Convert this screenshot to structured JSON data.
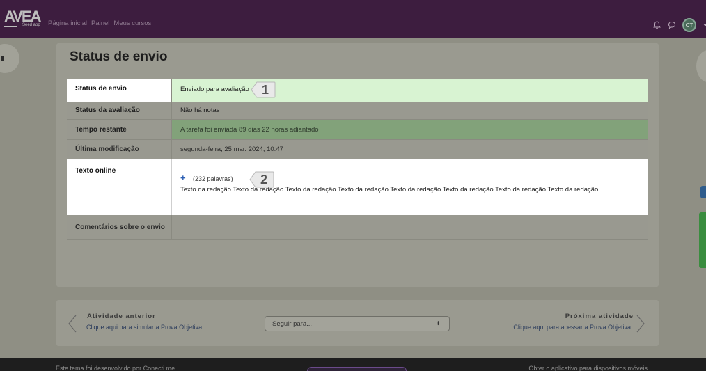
{
  "nav": {
    "logo_text": "AVEA",
    "logo_sub": "Seed app",
    "links": [
      "Página inicial",
      "Painel",
      "Meus cursos"
    ],
    "avatar_initials": "CT"
  },
  "page": {
    "title": "Status de envio"
  },
  "table": {
    "rows": [
      {
        "label": "Status de envio",
        "value": "Enviado para avaliação"
      },
      {
        "label": "Status da avaliação",
        "value": "Não há notas"
      },
      {
        "label": "Tempo restante",
        "value": "A tarefa foi enviada 89 dias 22 horas adiantado"
      },
      {
        "label": "Última modificação",
        "value": "segunda-feira, 25 mar. 2024, 10:47"
      },
      {
        "label": "Texto online",
        "value": ""
      },
      {
        "label": "Comentários sobre o envio",
        "value": ""
      }
    ],
    "online_text": {
      "expand_symbol": "+",
      "word_count": "(232 palavras)",
      "preview": "Texto da redação Texto da redação Texto da redação Texto da redação Texto da redação Texto da redação Texto da redação Texto da redação ..."
    }
  },
  "callouts": [
    "1",
    "2"
  ],
  "activity_nav": {
    "prev_title": "Atividade anterior",
    "prev_link": "Clique aqui para simular a Prova Objetiva",
    "jump_placeholder": "Seguir para...",
    "next_title": "Próxima atividade",
    "next_link": "Clique aqui para acessar a Prova Objetiva"
  },
  "footer": {
    "left": "Este tema foi desenvolvido por Conecti.me",
    "right": "Obter o aplicativo para dispositivos móveis"
  },
  "colors": {
    "topbar": "#3d1d3f",
    "overlay": "#8f8f84",
    "success_row": "#d8f3d2",
    "plus_blue": "#2c5fb4"
  }
}
